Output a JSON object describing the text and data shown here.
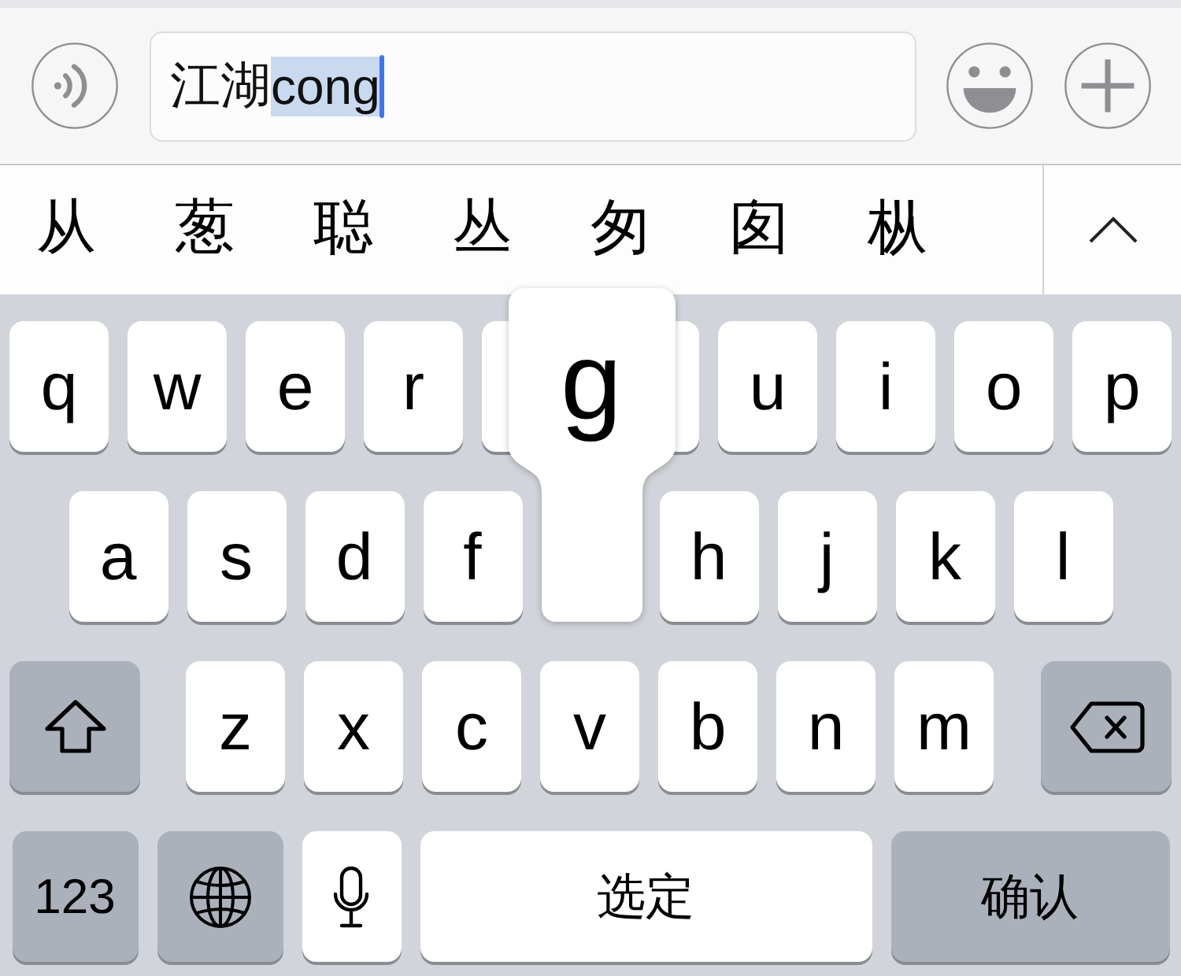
{
  "input_bar": {
    "text": "江湖",
    "composing": "cong"
  },
  "candidates": {
    "items": [
      "从",
      "葱",
      "聪",
      "丛",
      "匆",
      "囱",
      "枞"
    ]
  },
  "keyboard": {
    "rows": [
      {
        "keys": [
          {
            "kind": "letter",
            "label": "q",
            "pressed": false
          },
          {
            "kind": "letter",
            "label": "w",
            "pressed": false
          },
          {
            "kind": "letter",
            "label": "e",
            "pressed": false
          },
          {
            "kind": "letter",
            "label": "r",
            "pressed": false
          },
          {
            "kind": "covered",
            "pressed": false
          },
          {
            "kind": "covered",
            "pressed": false
          },
          {
            "kind": "letter",
            "label": "u",
            "pressed": false
          },
          {
            "kind": "letter",
            "label": "i",
            "pressed": false
          },
          {
            "kind": "letter",
            "label": "o",
            "pressed": false
          },
          {
            "kind": "letter",
            "label": "p",
            "pressed": false
          }
        ]
      },
      {
        "keys": [
          {
            "kind": "letter",
            "label": "a",
            "pressed": false
          },
          {
            "kind": "letter",
            "label": "s",
            "pressed": false
          },
          {
            "kind": "letter",
            "label": "d",
            "pressed": false
          },
          {
            "kind": "letter",
            "label": "f",
            "pressed": false
          },
          {
            "kind": "letter",
            "label": "g",
            "pressed": true
          },
          {
            "kind": "letter",
            "label": "h",
            "pressed": false
          },
          {
            "kind": "letter",
            "label": "j",
            "pressed": false
          },
          {
            "kind": "letter",
            "label": "k",
            "pressed": false
          },
          {
            "kind": "letter",
            "label": "l",
            "pressed": false
          }
        ]
      },
      {
        "keys": [
          {
            "kind": "shift",
            "pressed": false
          },
          {
            "kind": "letter",
            "label": "z",
            "pressed": false
          },
          {
            "kind": "letter",
            "label": "x",
            "pressed": false
          },
          {
            "kind": "letter",
            "label": "c",
            "pressed": false
          },
          {
            "kind": "letter",
            "label": "v",
            "pressed": false
          },
          {
            "kind": "letter",
            "label": "b",
            "pressed": false
          },
          {
            "kind": "letter",
            "label": "n",
            "pressed": false
          },
          {
            "kind": "letter",
            "label": "m",
            "pressed": false
          },
          {
            "kind": "delete",
            "pressed": false
          }
        ]
      },
      {
        "keys": [
          {
            "kind": "numbers",
            "label": "123",
            "pressed": false
          },
          {
            "kind": "globe",
            "pressed": false
          },
          {
            "kind": "mic",
            "pressed": false
          },
          {
            "kind": "space",
            "label": "选定",
            "pressed": false
          },
          {
            "kind": "return",
            "label": "确认",
            "pressed": false
          }
        ]
      }
    ]
  }
}
